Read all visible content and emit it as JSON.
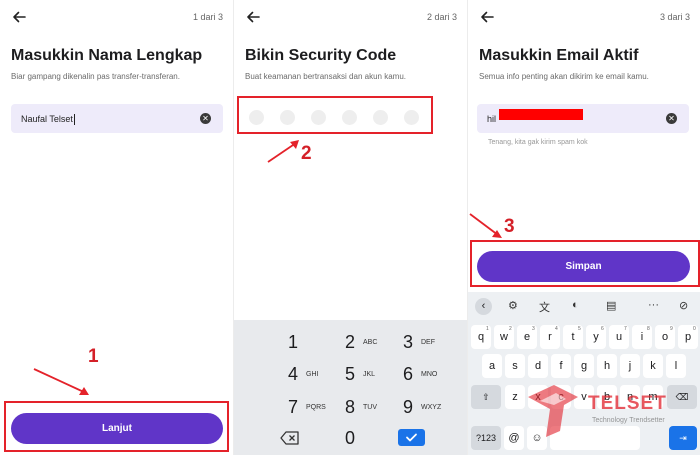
{
  "screens": [
    {
      "step": "1 dari 3",
      "title": "Masukkin Nama Lengkap",
      "subtitle": "Biar gampang dikenalin pas transfer-transferan.",
      "input_value": "Naufal Telset",
      "button_label": "Lanjut",
      "marker": "1"
    },
    {
      "step": "2 dari 3",
      "title": "Bikin Security Code",
      "subtitle": "Buat keamanan bertransaksi dan akun kamu.",
      "pin_length": 6,
      "marker": "2"
    },
    {
      "step": "3 dari 3",
      "title": "Masukkin Email Aktif",
      "subtitle": "Semua info penting akan dikirim ke email kamu.",
      "input_value": "hil",
      "hint": "Tenang, kita gak kirim spam kok",
      "button_label": "Simpan",
      "marker": "3"
    }
  ],
  "numpad": [
    {
      "num": "1",
      "letters": ""
    },
    {
      "num": "2",
      "letters": "ABC"
    },
    {
      "num": "3",
      "letters": "DEF"
    },
    {
      "num": "4",
      "letters": "GHI"
    },
    {
      "num": "5",
      "letters": "JKL"
    },
    {
      "num": "6",
      "letters": "MNO"
    },
    {
      "num": "7",
      "letters": "PQRS"
    },
    {
      "num": "8",
      "letters": "TUV"
    },
    {
      "num": "9",
      "letters": "WXYZ"
    },
    {
      "num": "0",
      "letters": ""
    }
  ],
  "keyboard": {
    "row1": [
      "q",
      "w",
      "e",
      "r",
      "t",
      "y",
      "u",
      "i",
      "o",
      "p"
    ],
    "row1_nums": [
      "1",
      "2",
      "3",
      "4",
      "5",
      "6",
      "7",
      "8",
      "9",
      "0"
    ],
    "row2": [
      "a",
      "s",
      "d",
      "f",
      "g",
      "h",
      "j",
      "k",
      "l"
    ],
    "row3": [
      "z",
      "x",
      "c",
      "v",
      "b",
      "n",
      "m"
    ],
    "sym_label": "?123",
    "at_label": "@"
  },
  "watermark": {
    "name": "TELSET",
    "tagline": "Technology Trendsetter"
  },
  "colors": {
    "accent": "#6035c8",
    "annotation": "#e4222a",
    "field_bg": "#eeebfa",
    "keyboard_bg": "#edf0f3"
  }
}
